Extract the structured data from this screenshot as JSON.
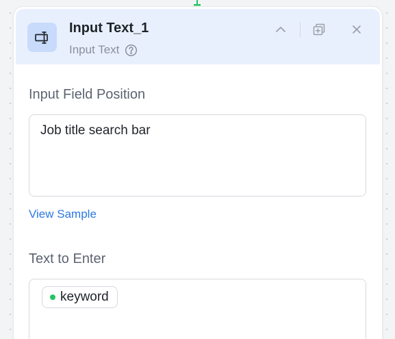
{
  "node": {
    "title": "Input Text_1",
    "subtitle": "Input Text",
    "icons": {
      "node": "input-text-icon",
      "help": "help-circle-icon",
      "collapse": "chevron-up-icon",
      "duplicate": "copy-icon",
      "close": "close-icon"
    }
  },
  "fields": {
    "position": {
      "label": "Input Field Position",
      "value": "Job title search bar",
      "link": "View Sample"
    },
    "text": {
      "label": "Text to Enter",
      "variable": "keyword"
    }
  },
  "colors": {
    "header_bg": "#e9f0fd",
    "icon_bg": "#c9dbfb",
    "link": "#2b78e4",
    "variable_dot": "#22c55e",
    "connector": "#22c55e"
  }
}
